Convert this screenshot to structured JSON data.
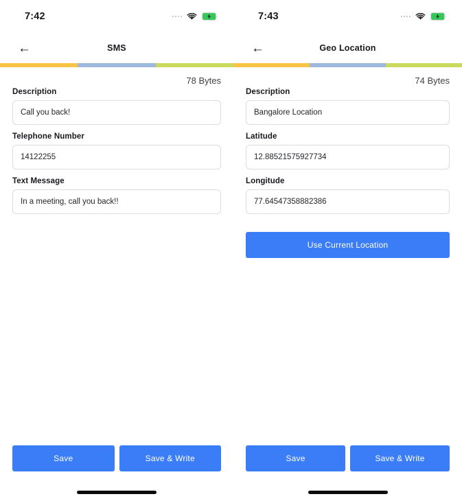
{
  "theme": {
    "accent_blue": "#3b7df6",
    "segment_yellow": "#f7c446",
    "segment_blue": "#9db9dd",
    "segment_green": "#cbd95c",
    "input_border": "#dcdde0",
    "text_primary": "#16181d"
  },
  "screens": [
    {
      "status": {
        "time": "7:42",
        "signal_icon": "signal-dots-icon",
        "wifi_icon": "wifi-icon",
        "battery_icon": "battery-charging-icon"
      },
      "nav": {
        "back_icon": "arrow-left-icon",
        "title": "SMS"
      },
      "progress": {
        "segments": [
          "yellow",
          "blue",
          "green"
        ]
      },
      "bytes_label": "78 Bytes",
      "fields": [
        {
          "label": "Description",
          "value": "Call you back!",
          "placeholder": "Description",
          "name": "description"
        },
        {
          "label": "Telephone Number",
          "value": "14122255",
          "placeholder": "Telephone Number",
          "name": "telephone-number"
        },
        {
          "label": "Text Message",
          "value": "In a meeting, call you back!!",
          "placeholder": "Text Message",
          "name": "text-message"
        }
      ],
      "primary_action": null,
      "bottom_actions": [
        {
          "label": "Save",
          "name": "save"
        },
        {
          "label": "Save & Write",
          "name": "save-and-write"
        }
      ]
    },
    {
      "status": {
        "time": "7:43",
        "signal_icon": "signal-dots-icon",
        "wifi_icon": "wifi-icon",
        "battery_icon": "battery-charging-icon"
      },
      "nav": {
        "back_icon": "arrow-left-icon",
        "title": "Geo Location"
      },
      "progress": {
        "segments": [
          "yellow",
          "blue",
          "green"
        ]
      },
      "bytes_label": "74 Bytes",
      "fields": [
        {
          "label": "Description",
          "value": "Bangalore Location",
          "placeholder": "Description",
          "name": "description"
        },
        {
          "label": "Latitude",
          "value": "12.88521575927734",
          "placeholder": "Latitude",
          "name": "latitude"
        },
        {
          "label": "Longitude",
          "value": "77.64547358882386",
          "placeholder": "Longitude",
          "name": "longitude"
        }
      ],
      "primary_action": {
        "label": "Use Current Location",
        "name": "use-current-location"
      },
      "bottom_actions": [
        {
          "label": "Save",
          "name": "save"
        },
        {
          "label": "Save & Write",
          "name": "save-and-write"
        }
      ]
    }
  ]
}
